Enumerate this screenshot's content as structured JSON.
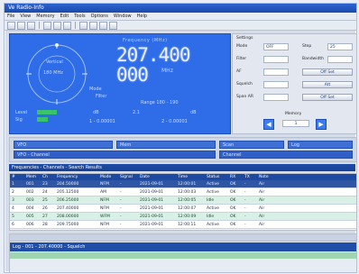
{
  "window": {
    "title": "Ve Radio-Info",
    "menu": [
      "File",
      "View",
      "Memory",
      "Edit",
      "Tools",
      "Options",
      "Window",
      "Help"
    ]
  },
  "main_panel": {
    "frequency_title": "Frequency (MHz)",
    "frequency": "207.400 000",
    "unit": "MHz",
    "compass_center": "Vertical",
    "compass_inner": "180 MHz",
    "labels": {
      "l1": "Mode",
      "l2": "Filter",
      "l3": "Range 180 - 190",
      "b1": "Level",
      "b2": "Sig",
      "b3": "dB",
      "b4": "2.1",
      "b5": "dB",
      "b6": "1 - 0.00001",
      "b7": "2 - 0.00001"
    }
  },
  "right_panel": {
    "title": "Settings",
    "row1_label": "Mode",
    "row1_value": "OFF",
    "row1b_label": "Step",
    "row1b_value": "25",
    "row2_label": "Filter",
    "row2_value": "",
    "row2b_label": "Bandwidth",
    "row2b_value": "",
    "row3_label": "AF",
    "row3_value": "",
    "row3b_label": "",
    "row3b_value": "Off Set",
    "row4_label": "Squelch",
    "row4_value": "",
    "row4b_value": "Att",
    "row5_label": "Span AR",
    "row5_value": "",
    "row5b_value": "Off Set",
    "nav_title": "Memory",
    "nav_value": "1"
  },
  "band": {
    "slot1": "VFO",
    "slot2": "Mem",
    "slot3": "Scan",
    "slot4": "Log",
    "slot1b": "VFO - Channel",
    "slot3b": "Channel"
  },
  "grid_title": "Frequencies  -  Channels  -  Search Results",
  "table": {
    "headers": [
      "#",
      "Mem",
      "Ch",
      "Frequency",
      "Mode",
      "Signal",
      "Date",
      "Time",
      "Status",
      "RX",
      "TX",
      "Note"
    ],
    "rows": [
      [
        "1",
        "001",
        "23",
        "204.50000",
        "NFM",
        "-",
        "2021-09-01",
        "12:00:01",
        "Active",
        "OK",
        "-",
        "Air"
      ],
      [
        "2",
        "002",
        "24",
        "205.12500",
        "AM",
        "-",
        "2021-09-01",
        "12:00:03",
        "Active",
        "OK",
        "-",
        "Air"
      ],
      [
        "3",
        "003",
        "25",
        "206.25000",
        "NFM",
        "-",
        "2021-09-01",
        "12:00:05",
        "Idle",
        "OK",
        "-",
        "Air"
      ],
      [
        "4",
        "004",
        "26",
        "207.40000",
        "NFM",
        "-",
        "2021-09-01",
        "12:00:07",
        "Active",
        "OK",
        "-",
        "Air"
      ],
      [
        "5",
        "005",
        "27",
        "208.00000",
        "WFM",
        "-",
        "2021-09-01",
        "12:00:09",
        "Idle",
        "OK",
        "-",
        "Air"
      ],
      [
        "6",
        "006",
        "28",
        "209.75000",
        "NFM",
        "-",
        "2021-09-01",
        "12:00:11",
        "Active",
        "OK",
        "-",
        "Air"
      ]
    ]
  },
  "bottom": {
    "bar_text": "Log  -  001  -  207.40000  -  Squelch",
    "strip_text": ""
  }
}
